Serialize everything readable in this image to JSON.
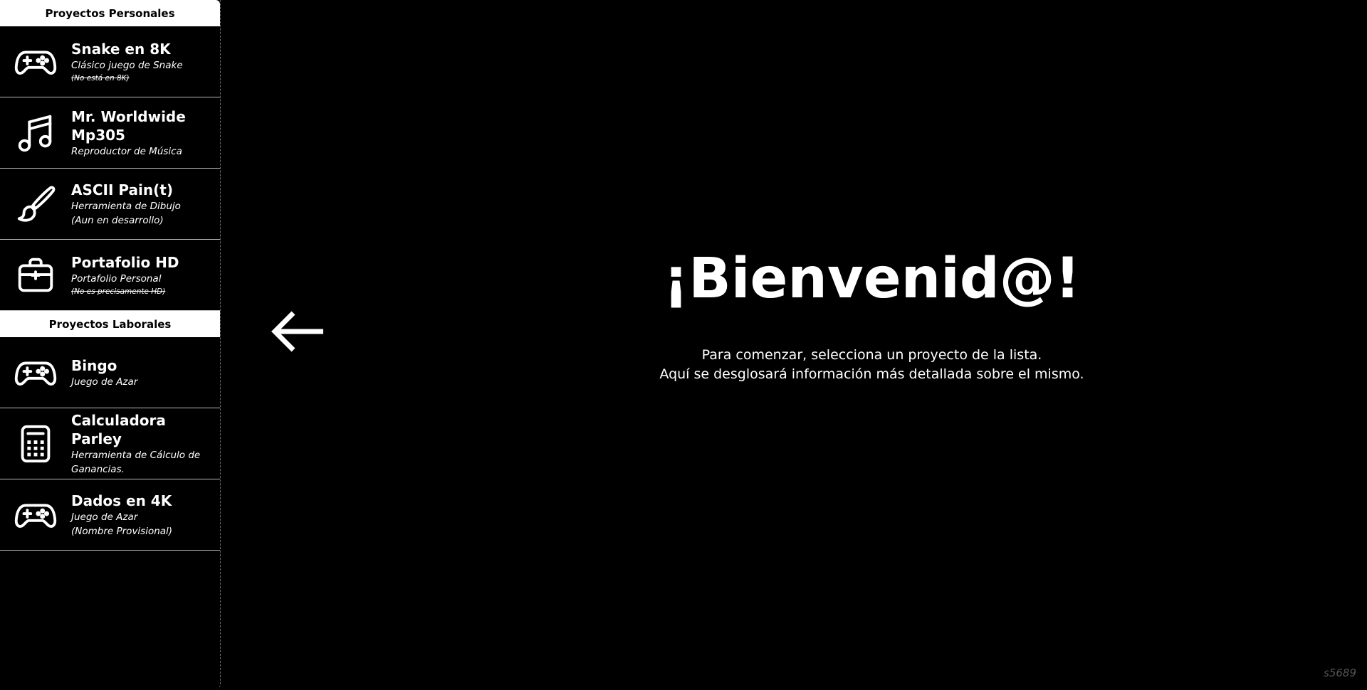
{
  "sidebar": {
    "personal_header": "Proyectos Personales",
    "work_header": "Proyectos Laborales",
    "personal_items": [
      {
        "title": "Snake en 8K",
        "desc": "Clásico juego de Snake",
        "note": "(No está en 8K)",
        "icon": "gamepad-icon"
      },
      {
        "title": "Mr. Worldwide Mp305",
        "desc": "Reproductor de Música",
        "note": "",
        "icon": "music-note-icon"
      },
      {
        "title": "ASCII Pain(t)",
        "desc": "Herramienta de Dibujo",
        "desc2": "(Aun en desarrollo)",
        "icon": "paintbrush-icon"
      },
      {
        "title": "Portafolio HD",
        "desc": "Portafolio Personal",
        "note": "(No es precisamente HD)",
        "icon": "briefcase-icon"
      }
    ],
    "work_items": [
      {
        "title": "Bingo",
        "desc": "Juego de Azar",
        "icon": "gamepad-icon"
      },
      {
        "title": "Calculadora Parley",
        "desc": "Herramienta de Cálculo de",
        "desc2": "Ganancias.",
        "icon": "calculator-icon"
      },
      {
        "title": "Dados en 4K",
        "desc": "Juego de Azar",
        "desc2": "(Nombre Provisional)",
        "icon": "gamepad-icon"
      }
    ]
  },
  "arrow_icon": "arrow-left-icon",
  "welcome": {
    "title": "¡Bienvenid@!",
    "line1": "Para comenzar, selecciona un proyecto de la lista.",
    "line2": "Aquí se desglosará información más detallada sobre el mismo."
  },
  "watermark": "s5689"
}
